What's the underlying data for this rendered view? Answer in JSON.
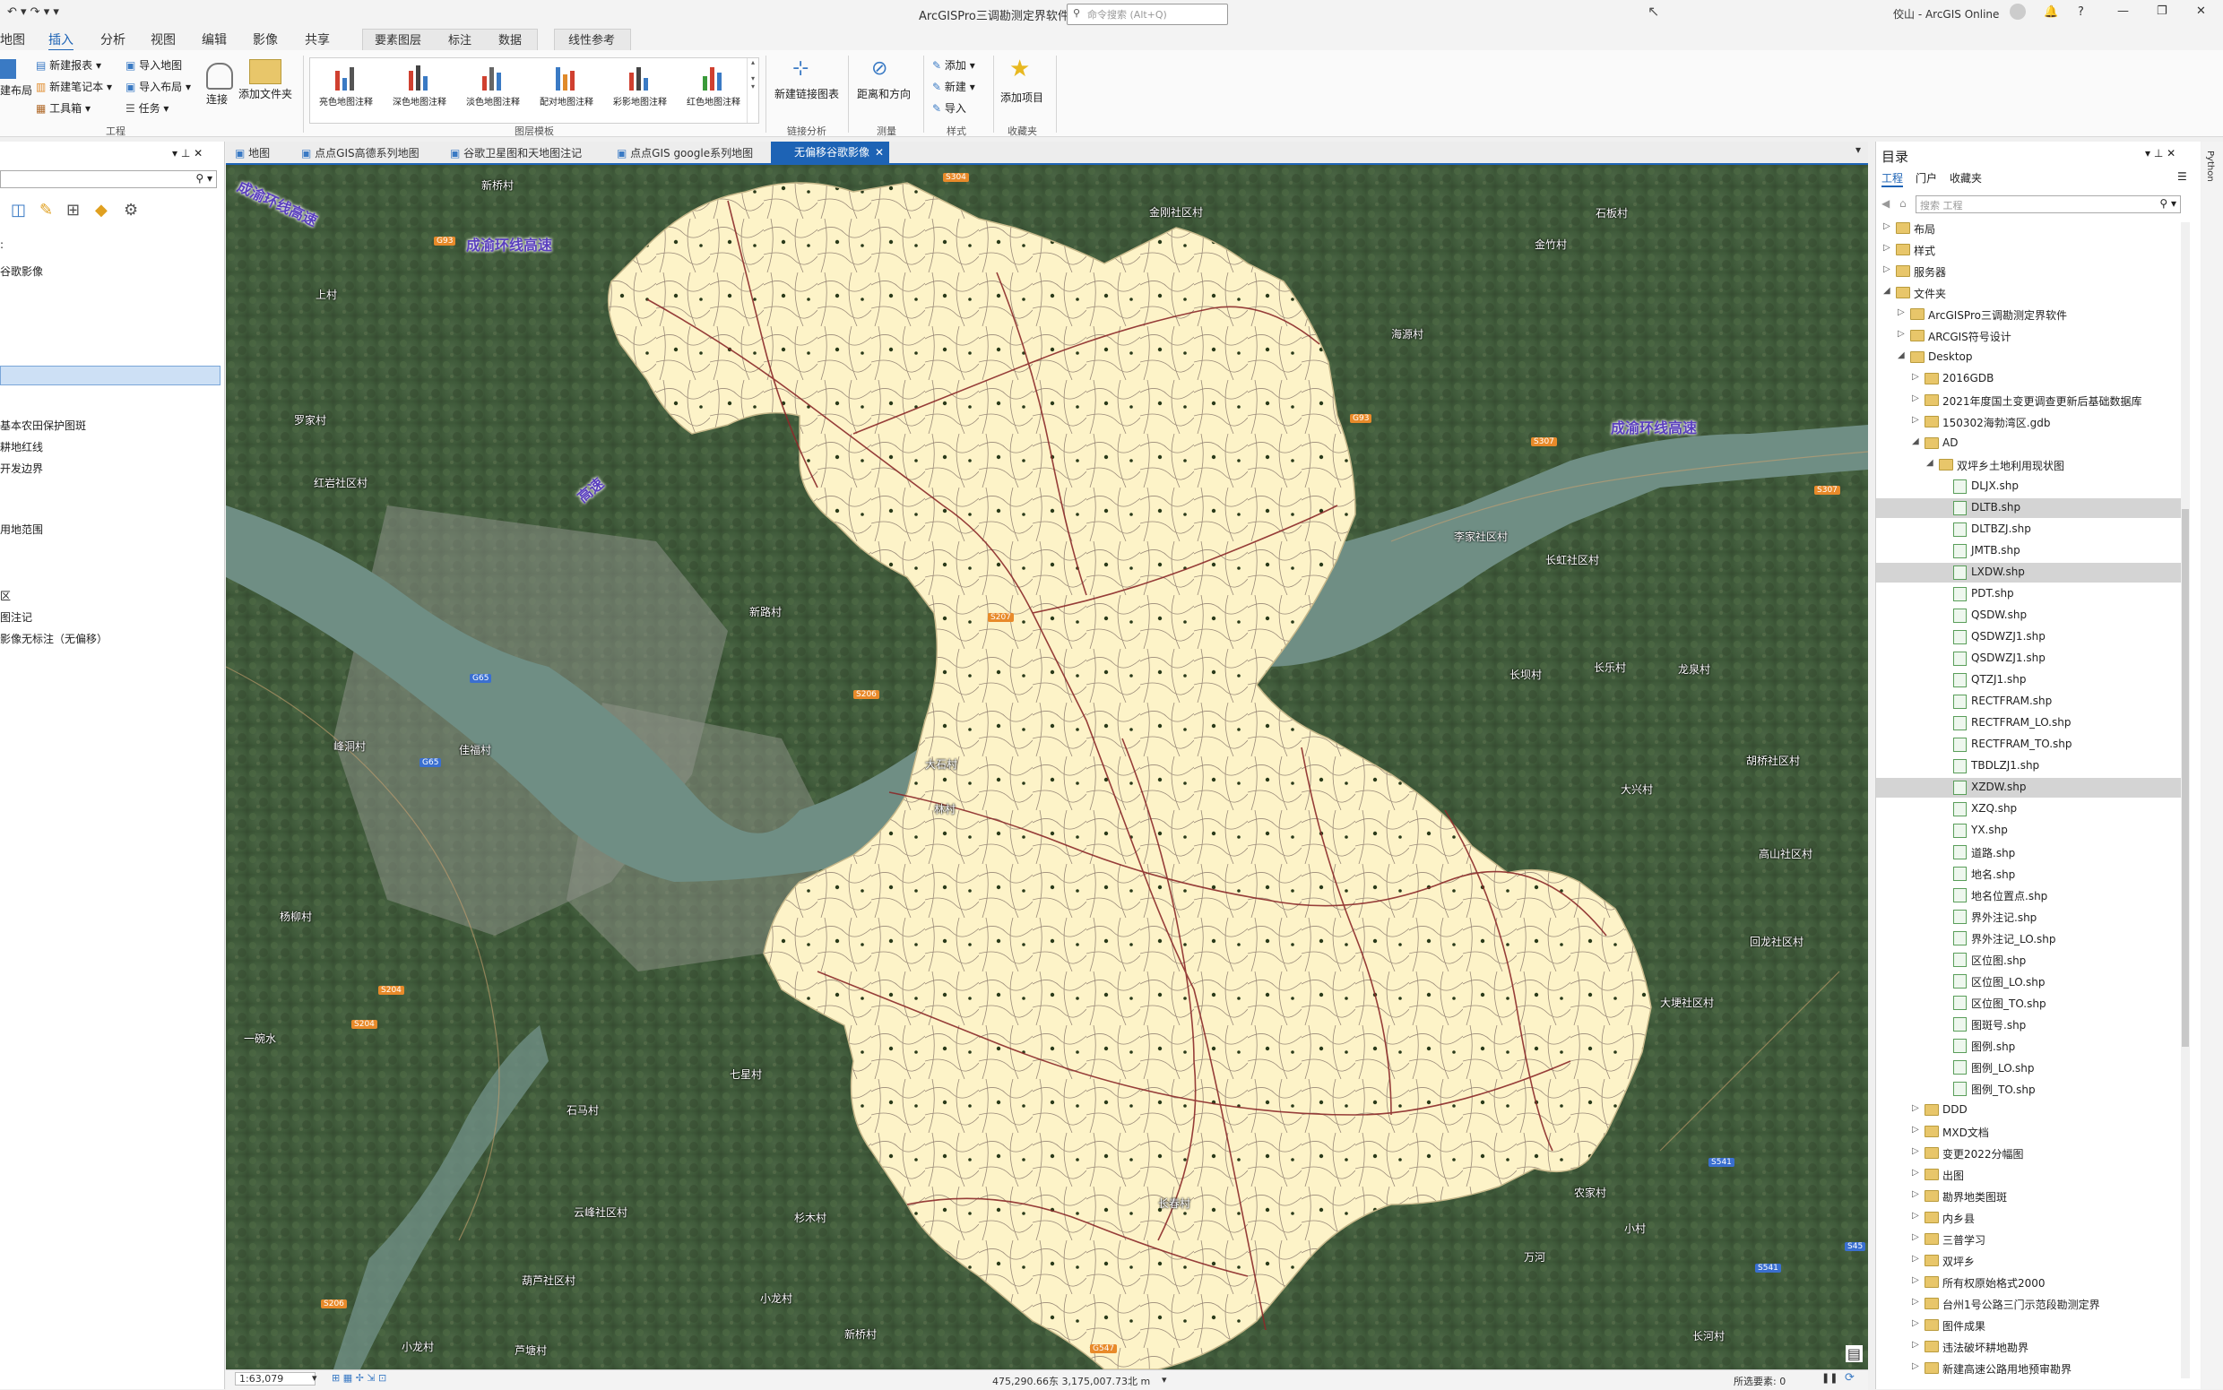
{
  "app": {
    "title": "ArcGISPro三调勘测定界软件",
    "search_placeholder": "命令搜索 (Alt+Q)",
    "user": "佼山 - ArcGIS Online"
  },
  "menu_tabs": [
    "地图",
    "插入",
    "分析",
    "视图",
    "编辑",
    "影像",
    "共享"
  ],
  "active_menu_tab": "插入",
  "context_tabs": {
    "group1": [
      "要素图层",
      "标注",
      "数据"
    ],
    "group2": [
      "线性参考"
    ]
  },
  "ribbon": {
    "project_group": {
      "items": [
        "新建报表",
        "新建笔记本",
        "工具箱",
        "导入地图",
        "导入布局",
        "任务",
        "连接",
        "添加文件夹"
      ],
      "partial_left": "建布局",
      "label": "工程"
    },
    "gallery": {
      "items": [
        "亮色地图注释",
        "深色地图注释",
        "淡色地图注释",
        "配对地图注释",
        "彩影地图注释",
        "红色地图注释"
      ],
      "label": "图层模板"
    },
    "link_group": {
      "item": "新建链接图表",
      "label": "链接分析"
    },
    "measure_group": {
      "item": "距离和方向",
      "label": "测量"
    },
    "style_group": {
      "items": [
        "添加",
        "新建",
        "导入"
      ],
      "label": "样式"
    },
    "favorite_group": {
      "item": "添加项目",
      "label": "收藏夹"
    }
  },
  "left_pane": {
    "items": [
      "谷歌影像",
      "基本农田保护图斑",
      "耕地红线",
      "开发边界",
      "用地范围",
      "区",
      "图注记",
      "影像无标注（无偏移）"
    ]
  },
  "view_tabs": [
    "地图",
    "点点GIS高德系列地图",
    "谷歌卫星图和天地图注记",
    "点点GIS google系列地图",
    "无偏移谷歌影像"
  ],
  "active_view_tab": "无偏移谷歌影像",
  "map_labels": {
    "roads": [
      "成渝环线高速",
      "成渝环线高速",
      "成渝环线高速",
      "高速"
    ],
    "places": [
      "新桥村",
      "金刚社区村",
      "石板村",
      "上村",
      "罗家村",
      "红岩社区村",
      "海源村",
      "金竹村",
      "李家社区村",
      "长虹社区村",
      "新路村",
      "长坝村",
      "长乐村",
      "龙泉村",
      "大石村",
      "林村",
      "大兴村",
      "胡桥社区村",
      "高山社区村",
      "峰洞村",
      "佳福村",
      "杨柳村",
      "一碗水",
      "大埂社区村",
      "回龙社区村",
      "石马村",
      "七星村",
      "云峰社区村",
      "杉木村",
      "长春村",
      "农家村",
      "小村",
      "万河",
      "葫芦社区村",
      "小龙村",
      "新桥村",
      "芦塘村",
      "长河村",
      "小龙村"
    ],
    "shields": [
      "S304",
      "G93",
      "G93",
      "S307",
      "S307",
      "S206",
      "S207",
      "G65",
      "G65",
      "S204",
      "S204",
      "S541",
      "S541",
      "G547",
      "S206",
      "S45"
    ]
  },
  "catalog": {
    "title": "目录",
    "tabs": [
      "工程",
      "门户",
      "收藏夹"
    ],
    "search_placeholder": "搜索 工程",
    "rows": [
      {
        "label": "布局",
        "indent": 0,
        "type": "root"
      },
      {
        "label": "样式",
        "indent": 0,
        "type": "root"
      },
      {
        "label": "服务器",
        "indent": 0,
        "type": "root"
      },
      {
        "label": "文件夹",
        "indent": 0,
        "type": "folder",
        "open": true
      },
      {
        "label": "ArcGISPro三调勘测定界软件",
        "indent": 1,
        "type": "folder"
      },
      {
        "label": "ARCGIS符号设计",
        "indent": 1,
        "type": "folder"
      },
      {
        "label": "Desktop",
        "indent": 1,
        "type": "folder",
        "open": true
      },
      {
        "label": "2016GDB",
        "indent": 2,
        "type": "folder"
      },
      {
        "label": "2021年度国土变更调查更新后基础数据库",
        "indent": 2,
        "type": "folder"
      },
      {
        "label": "150302海勃湾区.gdb",
        "indent": 2,
        "type": "folder"
      },
      {
        "label": "AD",
        "indent": 2,
        "type": "folder",
        "open": true
      },
      {
        "label": "双坪乡土地利用现状图",
        "indent": 3,
        "type": "folder",
        "open": true
      },
      {
        "label": "DLJX.shp",
        "indent": 4,
        "type": "shp"
      },
      {
        "label": "DLTB.shp",
        "indent": 4,
        "type": "shp",
        "selected": true
      },
      {
        "label": "DLTBZJ.shp",
        "indent": 4,
        "type": "shp"
      },
      {
        "label": "JMTB.shp",
        "indent": 4,
        "type": "shp"
      },
      {
        "label": "LXDW.shp",
        "indent": 4,
        "type": "shp",
        "selected": true
      },
      {
        "label": "PDT.shp",
        "indent": 4,
        "type": "shp"
      },
      {
        "label": "QSDW.shp",
        "indent": 4,
        "type": "shp"
      },
      {
        "label": "QSDWZJ1.shp",
        "indent": 4,
        "type": "shp"
      },
      {
        "label": "QSDWZJ1.shp",
        "indent": 4,
        "type": "shp"
      },
      {
        "label": "QTZJ1.shp",
        "indent": 4,
        "type": "shp"
      },
      {
        "label": "RECTFRAM.shp",
        "indent": 4,
        "type": "shp"
      },
      {
        "label": "RECTFRAM_LO.shp",
        "indent": 4,
        "type": "shp"
      },
      {
        "label": "RECTFRAM_TO.shp",
        "indent": 4,
        "type": "shp"
      },
      {
        "label": "TBDLZJ1.shp",
        "indent": 4,
        "type": "shp"
      },
      {
        "label": "XZDW.shp",
        "indent": 4,
        "type": "shp",
        "selected": true
      },
      {
        "label": "XZQ.shp",
        "indent": 4,
        "type": "shp"
      },
      {
        "label": "YX.shp",
        "indent": 4,
        "type": "shp"
      },
      {
        "label": "道路.shp",
        "indent": 4,
        "type": "shp"
      },
      {
        "label": "地名.shp",
        "indent": 4,
        "type": "shp"
      },
      {
        "label": "地名位置点.shp",
        "indent": 4,
        "type": "shp"
      },
      {
        "label": "界外注记.shp",
        "indent": 4,
        "type": "shp"
      },
      {
        "label": "界外注记_LO.shp",
        "indent": 4,
        "type": "shp"
      },
      {
        "label": "区位图.shp",
        "indent": 4,
        "type": "shp"
      },
      {
        "label": "区位图_LO.shp",
        "indent": 4,
        "type": "shp"
      },
      {
        "label": "区位图_TO.shp",
        "indent": 4,
        "type": "shp"
      },
      {
        "label": "图斑号.shp",
        "indent": 4,
        "type": "shp"
      },
      {
        "label": "图例.shp",
        "indent": 4,
        "type": "shp"
      },
      {
        "label": "图例_LO.shp",
        "indent": 4,
        "type": "shp"
      },
      {
        "label": "图例_TO.shp",
        "indent": 4,
        "type": "shp"
      },
      {
        "label": "DDD",
        "indent": 2,
        "type": "folder"
      },
      {
        "label": "MXD文档",
        "indent": 2,
        "type": "folder"
      },
      {
        "label": "变更2022分幅图",
        "indent": 2,
        "type": "folder"
      },
      {
        "label": "出图",
        "indent": 2,
        "type": "folder"
      },
      {
        "label": "勘界地类图斑",
        "indent": 2,
        "type": "folder"
      },
      {
        "label": "内乡县",
        "indent": 2,
        "type": "folder"
      },
      {
        "label": "三普学习",
        "indent": 2,
        "type": "folder"
      },
      {
        "label": "双坪乡",
        "indent": 2,
        "type": "folder"
      },
      {
        "label": "所有权原始格式2000",
        "indent": 2,
        "type": "folder"
      },
      {
        "label": "台州1号公路三门示范段勘测定界",
        "indent": 2,
        "type": "folder"
      },
      {
        "label": "图件成果",
        "indent": 2,
        "type": "folder"
      },
      {
        "label": "违法破坏耕地勘界",
        "indent": 2,
        "type": "folder"
      },
      {
        "label": "新建高速公路用地预审勘界",
        "indent": 2,
        "type": "folder"
      }
    ]
  },
  "statusbar": {
    "scale": "1:63,079",
    "coords": "475,290.66东 3,175,007.73北 m",
    "selected": "所选要素: 0"
  },
  "colors": {
    "accent": "#1d63b5",
    "boundary_fill": "#fdf3c8",
    "road_color": "#8b2a2a",
    "parcel_line": "#8a7a6a"
  }
}
